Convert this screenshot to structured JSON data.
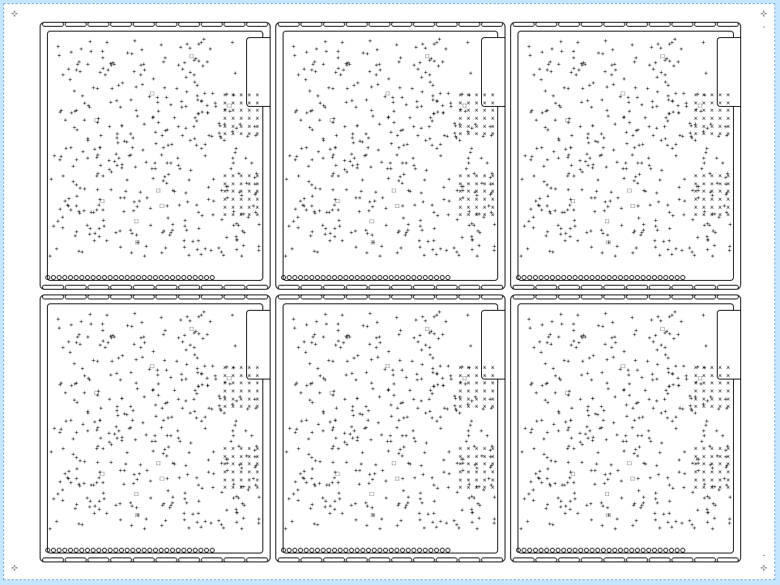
{
  "design": {
    "background_color": "#c5e6ff",
    "sheet_color": "#ffffff",
    "line_color": "#000000",
    "selection_dash_color": "#6aa8de"
  },
  "layout": {
    "rows": 2,
    "cols": 3,
    "panel_count": 6,
    "tabs_per_edge": 10,
    "bottom_hole_count": 30
  },
  "markers": {
    "top_left_glyph": "⊹",
    "top_right_glyph": "⊹",
    "bottom_left_glyph": "⊹",
    "bottom_right_glyph": "⊹",
    "extra_right_glyph": "·"
  },
  "panel_marks": {
    "hatch_glyph": "×",
    "scatter_glyph": "+",
    "square_glyph": "□",
    "hatch_rows": 6,
    "hatch_cols": 5,
    "scatter_density": 380
  }
}
